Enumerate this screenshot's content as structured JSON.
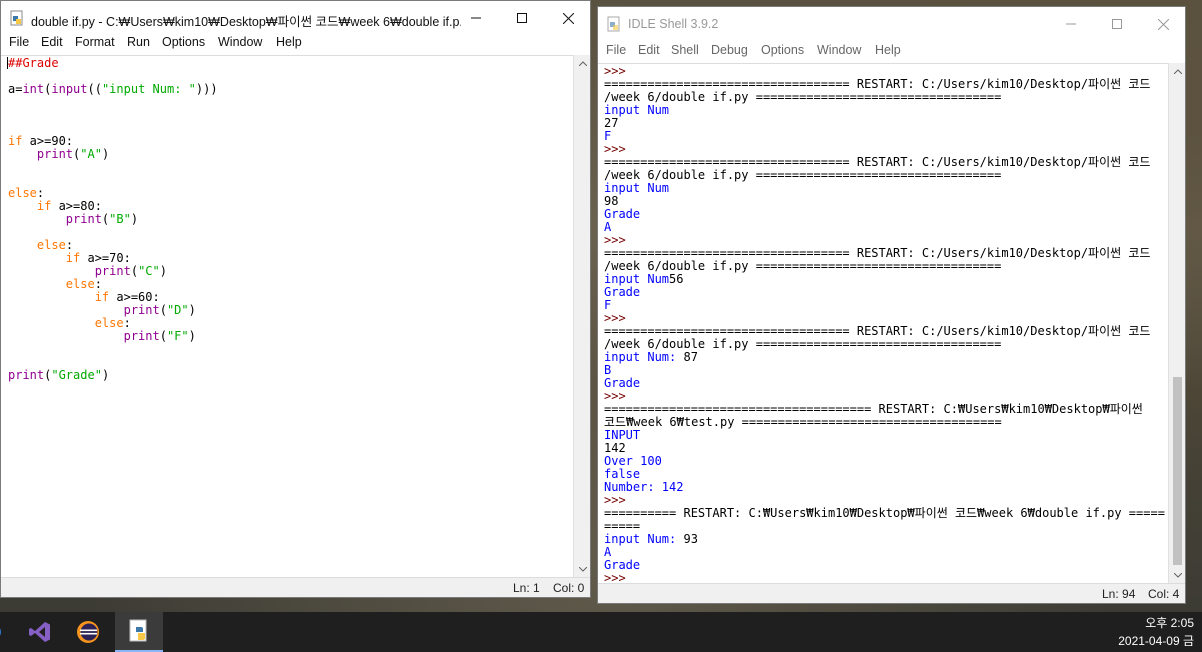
{
  "editor_window": {
    "title": "double if.py - C:₩Users₩kim10₩Desktop₩파이썬 코드₩week 6₩double if.p...",
    "menu": [
      "File",
      "Edit",
      "Format",
      "Run",
      "Options",
      "Window",
      "Help"
    ],
    "code": [
      "##Grade",
      "",
      "a=int(input((\"input Num: \")))",
      "",
      "",
      "",
      "if a>=90:",
      "    print(\"A\")",
      "",
      "",
      "else:",
      "    if a>=80:",
      "        print(\"B\")",
      "",
      "    else:",
      "        if a>=70:",
      "            print(\"C\")",
      "        else:",
      "            if a>=60:",
      "                print(\"D\")",
      "            else:",
      "                print(\"F\")",
      "",
      "",
      "print(\"Grade\")"
    ],
    "status_ln": "Ln: 1",
    "status_col": "Col: 0"
  },
  "shell_window": {
    "title": "IDLE Shell 3.9.2",
    "menu": [
      "File",
      "Edit",
      "Shell",
      "Debug",
      "Options",
      "Window",
      "Help"
    ],
    "lines": [
      {
        "t": ">>>",
        "c": "prm"
      },
      {
        "t": "================================== RESTART: C:/Users/kim10/Desktop/파이썬 코드",
        "c": "sh-line"
      },
      {
        "t": "/week 6/double if.py ==================================",
        "c": "sh-line"
      },
      {
        "t": "input Num",
        "c": "out"
      },
      {
        "t": "27",
        "c": "inp"
      },
      {
        "t": "F",
        "c": "out"
      },
      {
        "t": ">>>",
        "c": "prm"
      },
      {
        "t": "================================== RESTART: C:/Users/kim10/Desktop/파이썬 코드",
        "c": "sh-line"
      },
      {
        "t": "/week 6/double if.py ==================================",
        "c": "sh-line"
      },
      {
        "t": "input Num",
        "c": "out"
      },
      {
        "t": "98",
        "c": "inp"
      },
      {
        "t": "Grade",
        "c": "out"
      },
      {
        "t": "A",
        "c": "out"
      },
      {
        "t": ">>>",
        "c": "prm"
      },
      {
        "t": "================================== RESTART: C:/Users/kim10/Desktop/파이썬 코드",
        "c": "sh-line"
      },
      {
        "t": "/week 6/double if.py ==================================",
        "c": "sh-line"
      },
      {
        "t": "input Num56",
        "c": "out"
      },
      {
        "t": "Grade",
        "c": "out"
      },
      {
        "t": "F",
        "c": "out"
      },
      {
        "t": ">>>",
        "c": "prm"
      },
      {
        "t": "================================== RESTART: C:/Users/kim10/Desktop/파이썬 코드",
        "c": "sh-line"
      },
      {
        "t": "/week 6/double if.py ==================================",
        "c": "sh-line"
      },
      {
        "t": "input Num: 87",
        "c": "out"
      },
      {
        "t": "B",
        "c": "out"
      },
      {
        "t": "Grade",
        "c": "out"
      },
      {
        "t": ">>>",
        "c": "prm"
      },
      {
        "t": "===================================== RESTART: C:₩Users₩kim10₩Desktop₩파이썬",
        "c": "sh-line"
      },
      {
        "t": "코드₩week 6₩test.py ====================================",
        "c": "sh-line"
      },
      {
        "t": "INPUT",
        "c": "out"
      },
      {
        "t": "142",
        "c": "inp"
      },
      {
        "t": "Over 100",
        "c": "out"
      },
      {
        "t": "false",
        "c": "out"
      },
      {
        "t": "Number: 142",
        "c": "out"
      },
      {
        "t": ">>>",
        "c": "prm"
      },
      {
        "t": "========== RESTART: C:₩Users₩kim10₩Desktop₩파이썬 코드₩week 6₩double if.py =====",
        "c": "sh-line"
      },
      {
        "t": "=====",
        "c": "sh-line"
      },
      {
        "t": "input Num: 93",
        "c": "out"
      },
      {
        "t": "A",
        "c": "out"
      },
      {
        "t": "Grade",
        "c": "out"
      },
      {
        "t": ">>>",
        "c": "prm"
      }
    ],
    "status_ln": "Ln: 94",
    "status_col": "Col: 4"
  },
  "taskbar": {
    "apps": [
      "visual-studio-icon",
      "eclipse-icon",
      "python-idle-icon"
    ],
    "time": "오후 2:05",
    "date": "2021-04-09 금"
  }
}
